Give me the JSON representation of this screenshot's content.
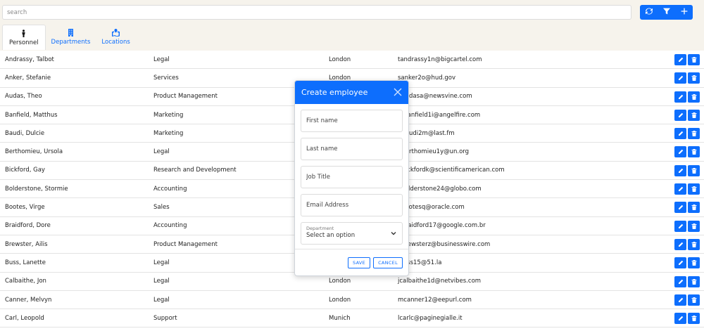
{
  "search": {
    "placeholder": "search",
    "value": ""
  },
  "toolbar": {
    "refresh_icon": "refresh-icon",
    "filter_icon": "filter-icon",
    "add_icon": "plus-icon",
    "accent": "#0d6efd"
  },
  "tabs": [
    {
      "label": "Personnel",
      "icon": "person-icon",
      "active": true
    },
    {
      "label": "Departments",
      "icon": "building-icon",
      "active": false
    },
    {
      "label": "Locations",
      "icon": "map-location-icon",
      "active": false
    }
  ],
  "rows": [
    {
      "name": "Andrassy, Talbot",
      "department": "Legal",
      "location": "London",
      "email": "tandrassy1n@bigcartel.com"
    },
    {
      "name": "Anker, Stefanie",
      "department": "Services",
      "location": "London",
      "email": "sanker2o@hud.gov"
    },
    {
      "name": "Audas, Theo",
      "department": "Product Management",
      "location": "",
      "email": "daudasa@newsvine.com"
    },
    {
      "name": "Banfield, Matthus",
      "department": "Marketing",
      "location": "",
      "email": "mbanfield1i@angelfire.com"
    },
    {
      "name": "Baudi, Dulcie",
      "department": "Marketing",
      "location": "",
      "email": "dbaudi2m@last.fm"
    },
    {
      "name": "Berthomieu, Ursola",
      "department": "Legal",
      "location": "",
      "email": "uberthomieu1y@un.org"
    },
    {
      "name": "Bickford, Gay",
      "department": "Research and Development",
      "location": "",
      "email": "gbickfordk@scientificamerican.com"
    },
    {
      "name": "Bolderstone, Stormie",
      "department": "Accounting",
      "location": "",
      "email": "sbolderstone24@globo.com"
    },
    {
      "name": "Bootes, Virge",
      "department": "Sales",
      "location": "",
      "email": "vbootesq@oracle.com"
    },
    {
      "name": "Braidford, Dore",
      "department": "Accounting",
      "location": "",
      "email": "dbraidford17@google.com.br"
    },
    {
      "name": "Brewster, Ailis",
      "department": "Product Management",
      "location": "",
      "email": "abrewsterz@businesswire.com"
    },
    {
      "name": "Buss, Lanette",
      "department": "Legal",
      "location": "",
      "email": "lbuss15@51.la"
    },
    {
      "name": "Calbaithe, Jon",
      "department": "Legal",
      "location": "London",
      "email": "jcalbaithe1d@netvibes.com"
    },
    {
      "name": "Canner, Melvyn",
      "department": "Legal",
      "location": "London",
      "email": "mcanner12@eepurl.com"
    },
    {
      "name": "Carl, Leopold",
      "department": "Support",
      "location": "Munich",
      "email": "lcarlc@paginegialle.it"
    },
    {
      "name": "",
      "department": "",
      "location": "",
      "email": ""
    }
  ],
  "modal": {
    "title": "Create employee",
    "first_name_placeholder": "First name",
    "last_name_placeholder": "Last name",
    "job_title_placeholder": "Job Title",
    "email_placeholder": "Email Address",
    "department_label": "Department",
    "department_value": "Select an option",
    "save_label": "SAVE",
    "cancel_label": "CANCEL"
  }
}
